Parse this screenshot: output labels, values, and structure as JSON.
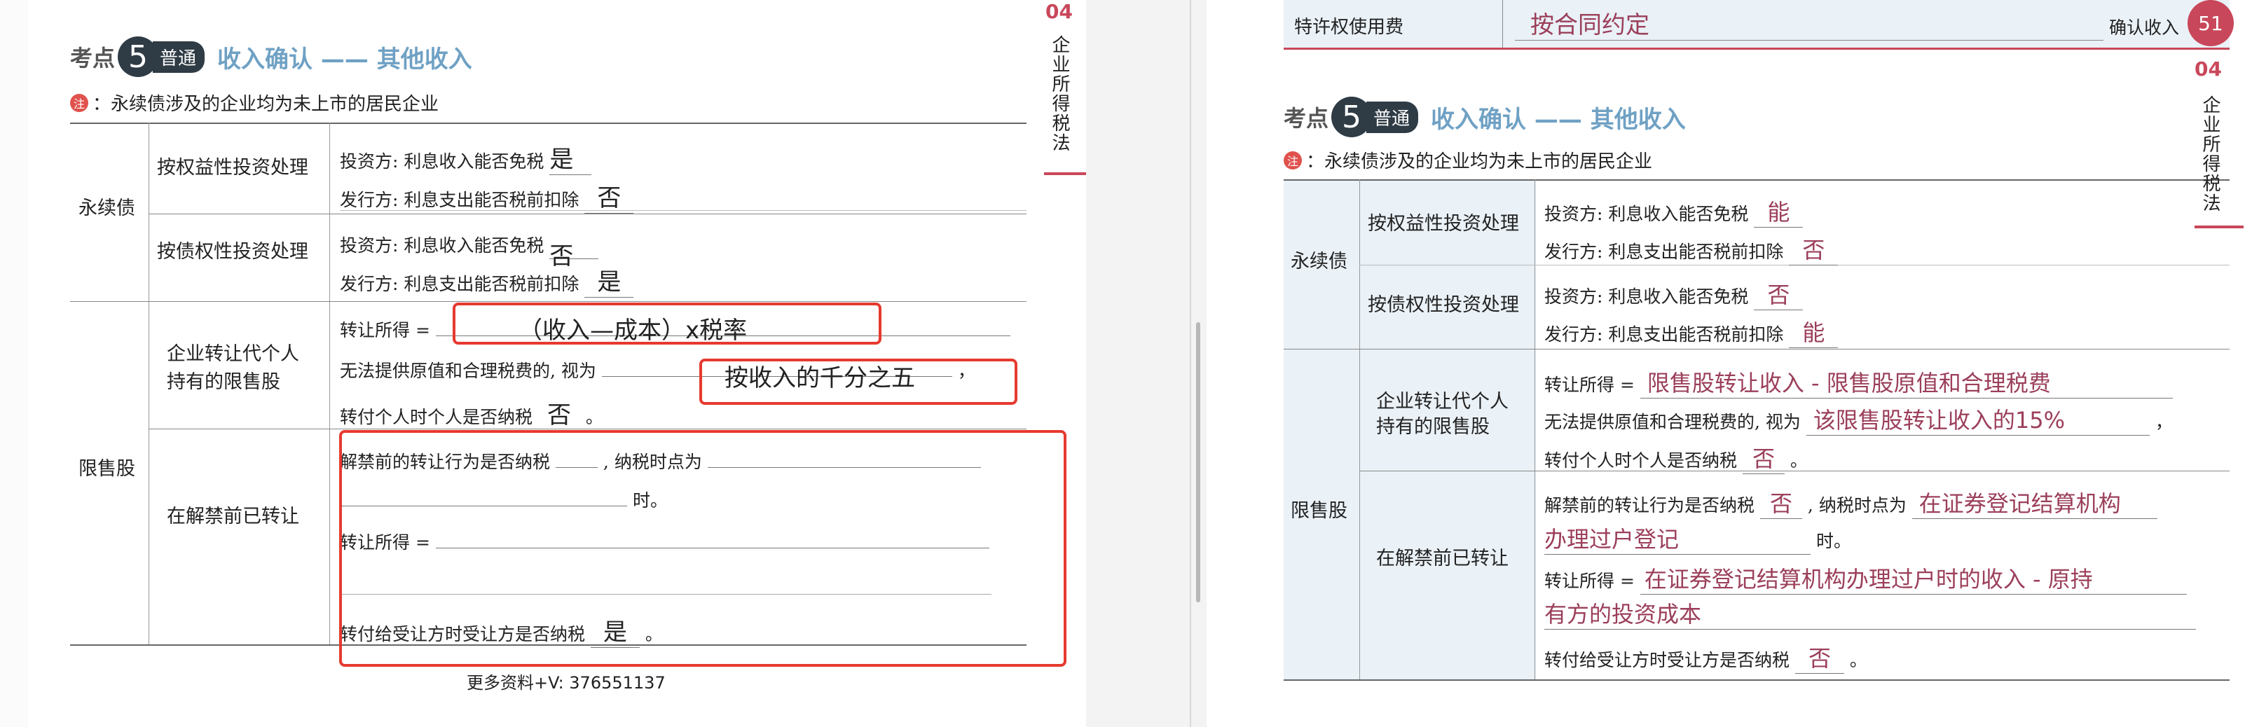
{
  "left": {
    "kaodian": "考点",
    "num": "5",
    "tag": "普通",
    "title": "收入确认 —— 其他收入",
    "note_icon": "注",
    "note": "：永续债涉及的企业均为未上市的居民企业",
    "yxz": "永续债",
    "equity": "按权益性投资处理",
    "debt": "按债权性投资处理",
    "eq_inv": "投资方: 利息收入能否免税",
    "eq_inv_ans": "是",
    "eq_iss": "发行方: 利息支出能否税前扣除",
    "eq_iss_ans": "否",
    "debt_inv": "投资方: 利息收入能否免税",
    "debt_inv_ans": "否",
    "debt_iss": "发行方: 利息支出能否税前扣除",
    "debt_iss_ans": "是",
    "xss": "限售股",
    "corp1": "企业转让代个人",
    "corp2": "持有的限售股",
    "zr": "转让所得 =",
    "zr_ans": "（收入—成本）x税率",
    "wf": "无法提供原值和合理税费的, 视为",
    "wf_ans": "按收入的千分之五",
    "comma": "，",
    "zg": "转付个人时个人是否纳税",
    "zg_ans": "否",
    "period": "。",
    "before": "在解禁前已转让",
    "b1": "解禁前的转让行为是否纳税",
    "b1b": ", 纳税时点为",
    "b2": "时。",
    "b3": "转让所得 =",
    "b4": "转付给受让方时受让方是否纳税",
    "b4_ans": "是",
    "footer": "更多资料+V:  376551137",
    "tab_num": "04",
    "tab_text": "企业所得税法"
  },
  "right": {
    "top_label": "特许权使用费",
    "top_ans": "按合同约定",
    "top_right": "确认收入",
    "kaodian": "考点",
    "num": "5",
    "tag": "普通",
    "title": "收入确认 —— 其他收入",
    "note_icon": "注",
    "note": "：永续债涉及的企业均为未上市的居民企业",
    "yxz": "永续债",
    "equity": "按权益性投资处理",
    "debt": "按债权性投资处理",
    "eq_inv": "投资方: 利息收入能否免税",
    "eq_inv_ans": "能",
    "eq_iss": "发行方: 利息支出能否税前扣除",
    "eq_iss_ans": "否",
    "debt_inv": "投资方: 利息收入能否免税",
    "debt_inv_ans": "否",
    "debt_iss": "发行方: 利息支出能否税前扣除",
    "debt_iss_ans": "能",
    "xss": "限售股",
    "corp1": "企业转让代个人",
    "corp2": "持有的限售股",
    "zr": "转让所得 =",
    "zr_ans": "限售股转让收入 - 限售股原值和合理税费",
    "wf": "无法提供原值和合理税费的, 视为",
    "wf_ans": "该限售股转让收入的15%",
    "comma": "，",
    "zg": "转付个人时个人是否纳税",
    "zg_ans": "否",
    "period": "。",
    "before": "在解禁前已转让",
    "b1": "解禁前的转让行为是否纳税",
    "b1_ans": "否",
    "b1b": ", 纳税时点为",
    "b1b_ans": "在证券登记结算机构",
    "b2_ans": "办理过户登记",
    "b2": "时。",
    "b3": "转让所得 =",
    "b3_ans": "在证券登记结算机构办理过户时的收入 - 原持",
    "b3b_ans": "有方的投资成本",
    "b4": "转付给受让方时受让方是否纳税",
    "b4_ans": "否",
    "page_no": "51",
    "tab_num": "04",
    "tab_text": "企业所得税法"
  }
}
